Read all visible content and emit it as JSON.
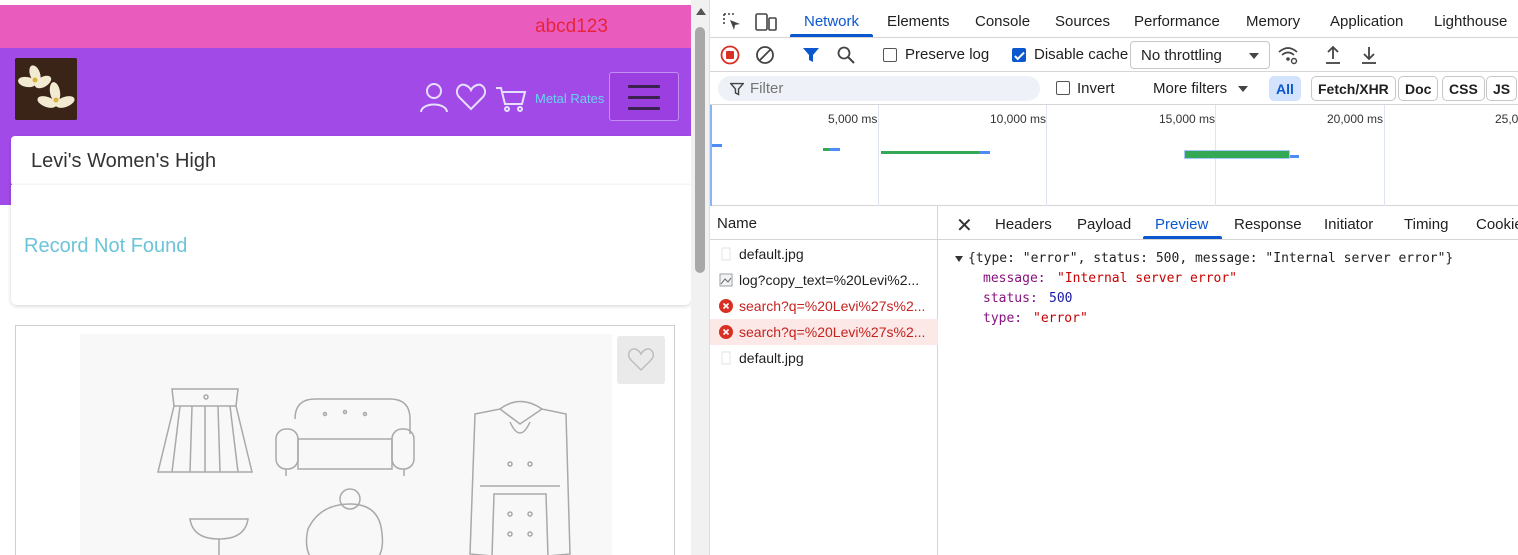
{
  "site": {
    "username": "abcd123",
    "metal_rates": "Metal Rates",
    "search_value": "Levi's Women's High",
    "record_message": "Record Not Found"
  },
  "devtools": {
    "tabs": [
      "Network",
      "Elements",
      "Console",
      "Sources",
      "Performance",
      "Memory",
      "Application",
      "Lighthouse"
    ],
    "active_tab": "Network",
    "toolbar": {
      "preserve_log": "Preserve log",
      "disable_cache": "Disable cache",
      "throttling": "No throttling"
    },
    "filter": {
      "placeholder": "Filter",
      "invert": "Invert",
      "more_filters": "More filters",
      "chips": [
        "All",
        "Fetch/XHR",
        "Doc",
        "CSS",
        "JS"
      ]
    },
    "timeline_labels": [
      "5,000 ms",
      "10,000 ms",
      "15,000 ms",
      "20,000 ms",
      "25,0"
    ],
    "requests_header": "Name",
    "requests": [
      {
        "name": "default.jpg",
        "status": "ok"
      },
      {
        "name": "log?copy_text=%20Levi%2...",
        "status": "ok"
      },
      {
        "name": "search?q=%20Levi%27s%2...",
        "status": "error"
      },
      {
        "name": "search?q=%20Levi%27s%2...",
        "status": "error",
        "selected": true
      },
      {
        "name": "default.jpg",
        "status": "ok"
      }
    ],
    "detail_tabs": [
      "Headers",
      "Payload",
      "Preview",
      "Response",
      "Initiator",
      "Timing",
      "Cookie"
    ],
    "active_detail_tab": "Preview",
    "preview": {
      "summary": "{type: \"error\", status: 500, message: \"Internal server error\"}",
      "fields": [
        {
          "key": "message",
          "value": "\"Internal server error\"",
          "kind": "str"
        },
        {
          "key": "status",
          "value": "500",
          "kind": "num"
        },
        {
          "key": "type",
          "value": "\"error\"",
          "kind": "str"
        }
      ]
    }
  }
}
